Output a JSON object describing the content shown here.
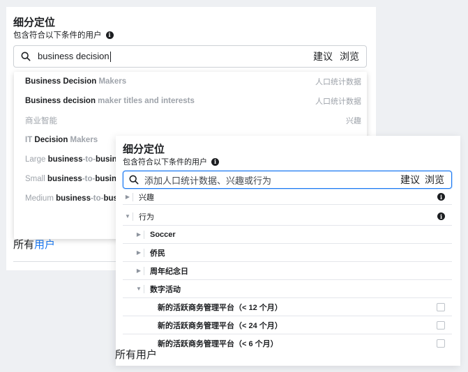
{
  "back_panel": {
    "title": "细分定位",
    "subtitle": "包含符合以下条件的用户",
    "search": {
      "value": "business decision",
      "suggest_label": "建议",
      "browse_label": "浏览"
    },
    "suggestions": [
      {
        "strong": "Business Decision",
        "light": " Makers",
        "category": "人口统计数据"
      },
      {
        "strong": "Business decision",
        "light": " maker titles and interests",
        "category": "人口统计数据"
      },
      {
        "plain": "商业智能",
        "category": "兴趣"
      },
      {
        "light_pre": "IT ",
        "strong": "Decision",
        "light": " Makers",
        "category": ""
      },
      {
        "plain": "Large ",
        "strong": "business",
        "light": "-to-",
        "strong2": "busine",
        "category": ""
      },
      {
        "plain": "Small ",
        "strong": "business",
        "light": "-to-",
        "strong2": "busine",
        "category": ""
      },
      {
        "plain": "Medium ",
        "strong": "business",
        "light": "-to-",
        "strong2": "bus",
        "category": ""
      }
    ],
    "footer_fragment_a": "所有",
    "footer_fragment_b": "用户"
  },
  "front_panel": {
    "title": "细分定位",
    "subtitle": "包含符合以下条件的用户",
    "search": {
      "placeholder": "添加人口统计数据、兴趣或行为",
      "suggest_label": "建议",
      "browse_label": "浏览"
    },
    "tree": [
      {
        "label": "兴趣"
      },
      {
        "label": "行为"
      },
      {
        "label": "Soccer"
      },
      {
        "label": "侨民"
      },
      {
        "label": "周年纪念日"
      },
      {
        "label": "数字活动"
      },
      {
        "label": "新的活跃商务管理平台（< 12 个月）"
      },
      {
        "label": "新的活跃商务管理平台（< 24 个月）"
      },
      {
        "label": "新的活跃商务管理平台（< 6 个月）"
      }
    ],
    "footer_fragment": "所有用户"
  },
  "colors": {
    "accent": "#1877f2",
    "muted": "#9ea3aa"
  }
}
